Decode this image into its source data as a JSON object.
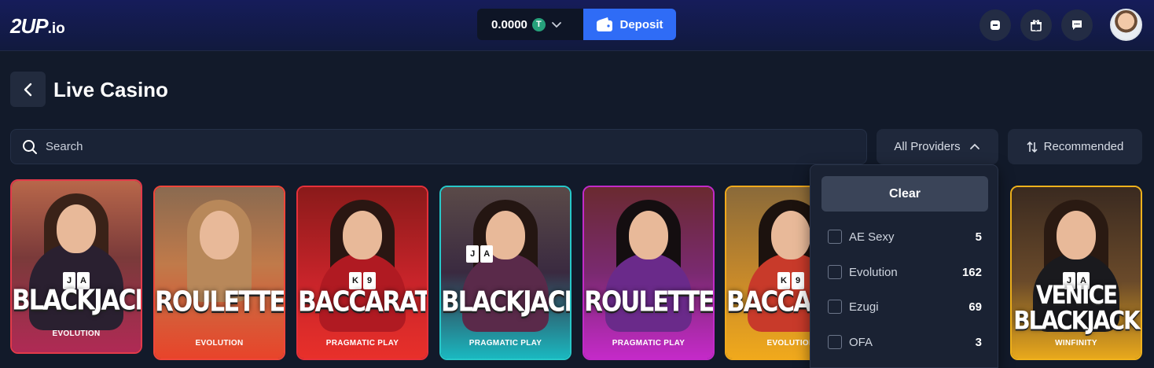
{
  "header": {
    "logo_main": "2UP",
    "logo_suffix": ".io",
    "balance": "0.0000",
    "currency_symbol": "T",
    "deposit_label": "Deposit"
  },
  "page": {
    "title": "Live Casino"
  },
  "search": {
    "placeholder": "Search"
  },
  "filters": {
    "providers_label": "All Providers",
    "sort_label": "Recommended"
  },
  "games": [
    {
      "name": "BLACKJACK",
      "provider": "EVOLUTION",
      "border": "#e23a4a"
    },
    {
      "name": "ROULETTE",
      "provider": "EVOLUTION",
      "border": "#f0463a"
    },
    {
      "name": "BACCARAT",
      "provider": "PRAGMATIC PLAY",
      "border": "#e7303a"
    },
    {
      "name": "BLACKJACK",
      "provider": "PRAGMATIC PLAY",
      "border": "#27c8c9"
    },
    {
      "name": "ROULETTE",
      "provider": "PRAGMATIC PLAY",
      "border": "#c22ac8"
    },
    {
      "name": "BACCARAT",
      "provider": "EVOLUTION",
      "border": "#f0a91c"
    },
    {
      "name_line1": "VENICE",
      "name_line2": "BLACKJACK",
      "provider": "WINFINITY",
      "border": "#f0b21c"
    }
  ],
  "provider_dropdown": {
    "clear_label": "Clear",
    "items": [
      {
        "name": "AE Sexy",
        "count": "5"
      },
      {
        "name": "Evolution",
        "count": "162"
      },
      {
        "name": "Ezugi",
        "count": "69"
      },
      {
        "name": "OFA",
        "count": "3"
      }
    ]
  }
}
